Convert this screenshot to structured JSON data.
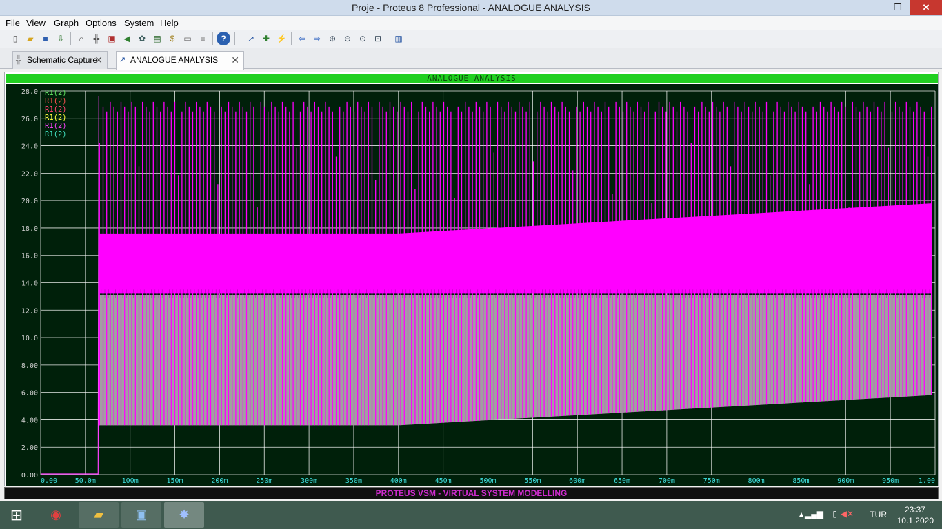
{
  "window": {
    "title": "Proje - Proteus 8 Professional - ANALOGUE ANALYSIS",
    "min_label": "—",
    "max_label": "❐",
    "close_label": "✕"
  },
  "menu": [
    "File",
    "View",
    "Graph",
    "Options",
    "System",
    "Help"
  ],
  "toolbar_icons": [
    "new-file-icon",
    "open-folder-icon",
    "save-icon",
    "import-icon",
    "home-icon",
    "schematic-icon",
    "pcb-icon",
    "gallery-icon",
    "visual-designer-icon",
    "bom-icon",
    "source-code-icon",
    "design-explorer-icon",
    "notes-icon",
    "help-icon",
    "edit-graph-icon",
    "add-trace-icon",
    "simulate-graph-icon",
    "nav-left-icon",
    "nav-right-icon",
    "zoom-in-icon",
    "zoom-out-icon",
    "zoom-all-icon",
    "zoom-area-icon",
    "view-log-icon"
  ],
  "tabs": [
    {
      "label": "Schematic Capture",
      "icon": "schematic-icon",
      "active": false
    },
    {
      "label": "ANALOGUE ANALYSIS",
      "icon": "graph-icon",
      "active": true
    }
  ],
  "graph": {
    "title": "ANALOGUE ANALYSIS",
    "bg_color": "#00200a",
    "grid_color": "#ffffff"
  },
  "chart_data": {
    "type": "line",
    "title": "ANALOGUE ANALYSIS",
    "xlabel": "",
    "ylabel": "",
    "xlim": [
      0,
      1.0
    ],
    "ylim": [
      0,
      28
    ],
    "grid": true,
    "legend_position": "top-left",
    "x_ticks": [
      "0.00",
      "50.0m",
      "100m",
      "150m",
      "200m",
      "250m",
      "300m",
      "350m",
      "400m",
      "450m",
      "500m",
      "550m",
      "600m",
      "650m",
      "700m",
      "750m",
      "800m",
      "850m",
      "900m",
      "950m",
      "1.00"
    ],
    "y_ticks": [
      "0.00",
      "2.00",
      "4.00",
      "6.00",
      "8.00",
      "10.0",
      "12.0",
      "14.0",
      "16.0",
      "18.0",
      "20.0",
      "22.0",
      "24.0",
      "26.0",
      "28.0"
    ],
    "series": [
      {
        "name": "R1(2)",
        "color": "#60e060",
        "switch_on": 0.065,
        "low_start": 3.6,
        "low_end": 3.6,
        "high_start": 13.2,
        "high_end": 13.2
      },
      {
        "name": "R1(2)",
        "color": "#ff5050",
        "switch_on": 0.065,
        "low_start": 3.6,
        "low_end": 3.6,
        "high_start": 13.2,
        "high_end": 13.2
      },
      {
        "name": "R1(2)",
        "color": "#ff4070",
        "switch_on": 0.065,
        "low_start": 3.6,
        "low_end": 3.6,
        "high_start": 13.2,
        "high_end": 13.2
      },
      {
        "name": "R1(2)",
        "color": "#ffff40",
        "switch_on": 0.065,
        "low_start": 3.6,
        "low_end": 3.6,
        "high_start": 13.2,
        "high_end": 13.2
      },
      {
        "name": "R1(2)",
        "color": "#ff40ff",
        "switch_on": 0.065,
        "low_start": 13.2,
        "low_end": 13.2,
        "high_start": 17.6,
        "high_end": 19.8,
        "peak": 27.2
      },
      {
        "name": "R1(2)",
        "color": "#40e0c0",
        "switch_on": 0.065,
        "low_start": 3.6,
        "low_end": 5.8,
        "high_start": 13.2,
        "high_end": 13.0
      }
    ],
    "gray_band": {
      "color": "#a0a0a0",
      "low_start": 3.6,
      "low_end": 5.8,
      "high": 13.1
    },
    "magenta_band": {
      "color": "#ff00ff",
      "low": 13.2,
      "high_start": 17.6,
      "high_end": 19.8,
      "spike_top": 27.2
    },
    "transition_at": 0.4
  },
  "statusbar": {
    "text": "PROTEUS VSM - VIRTUAL SYSTEM MODELLING"
  },
  "taskbar": {
    "apps": [
      "windows-start-icon",
      "chrome-icon",
      "file-explorer-icon",
      "photos-icon",
      "proteus-icon"
    ],
    "lang": "TUR",
    "time": "23:37",
    "date": "10.1.2020"
  }
}
